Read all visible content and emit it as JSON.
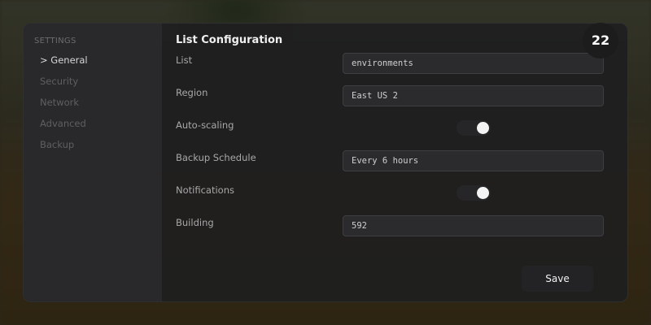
{
  "sidebar": {
    "heading": "SETTINGS",
    "items": [
      {
        "label": "> General",
        "active": true
      },
      {
        "label": "Security",
        "active": false
      },
      {
        "label": "Network",
        "active": false
      },
      {
        "label": "Advanced",
        "active": false
      },
      {
        "label": "Backup",
        "active": false
      }
    ]
  },
  "main": {
    "title": "List Configuration",
    "fields": {
      "list": {
        "label": "List",
        "value": "environments"
      },
      "region": {
        "label": "Region",
        "value": "East US 2"
      },
      "auto_scaling": {
        "label": "Auto-scaling",
        "enabled": true
      },
      "backup_schedule": {
        "label": "Backup Schedule",
        "value": "Every 6 hours"
      },
      "notifications": {
        "label": "Notifications",
        "enabled": true
      },
      "building": {
        "label": "Building",
        "value": "592"
      }
    },
    "save_label": "Save"
  },
  "badge": {
    "value": "22"
  },
  "colors": {
    "panel_bg": "#1e1e20",
    "sidebar_bg": "#2a2a2c",
    "field_bg": "#2b2b2d",
    "toggle_knob": "#f4f4f4",
    "badge_bg": "#1c1c1c"
  }
}
